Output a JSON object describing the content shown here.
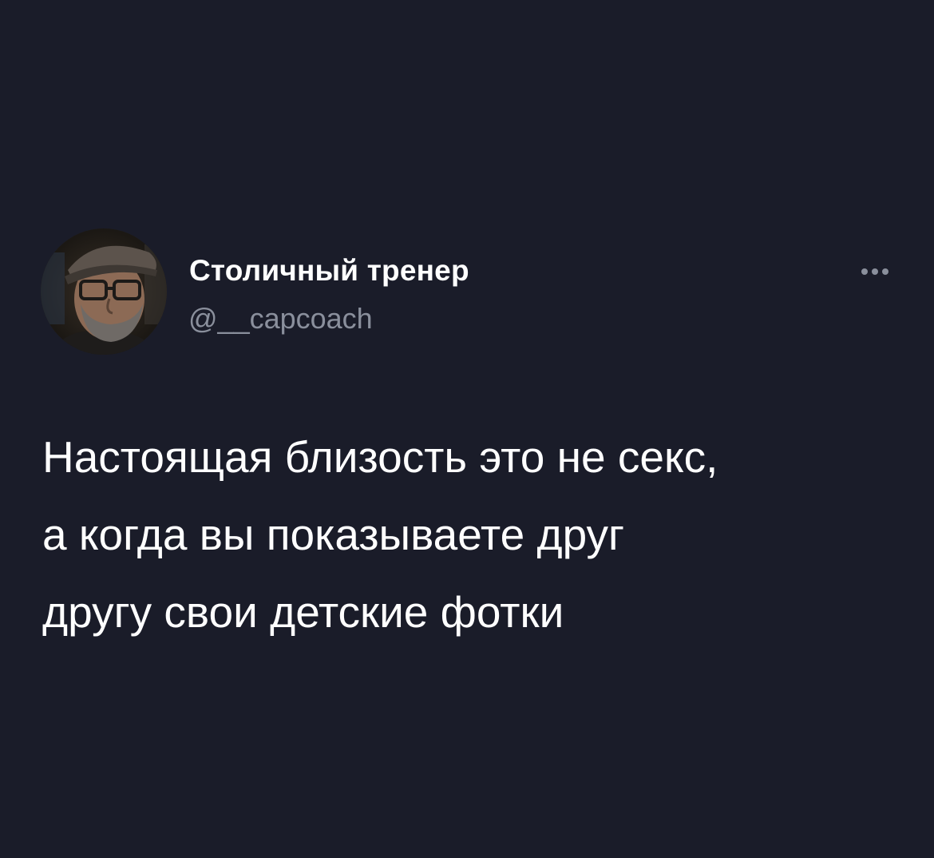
{
  "tweet": {
    "author": {
      "display_name": "Столичный тренер",
      "handle": "@__capcoach",
      "avatar_icon": "user-photo-avatar"
    },
    "more_icon": "more-horizontal-icon",
    "text_lines": [
      "Настоящая близость это не секс,",
      "а когда вы показываете друг",
      "другу свои детские фотки"
    ]
  },
  "colors": {
    "background": "#1a1c29",
    "text_primary": "#ffffff",
    "text_secondary": "#8a8f9c"
  }
}
